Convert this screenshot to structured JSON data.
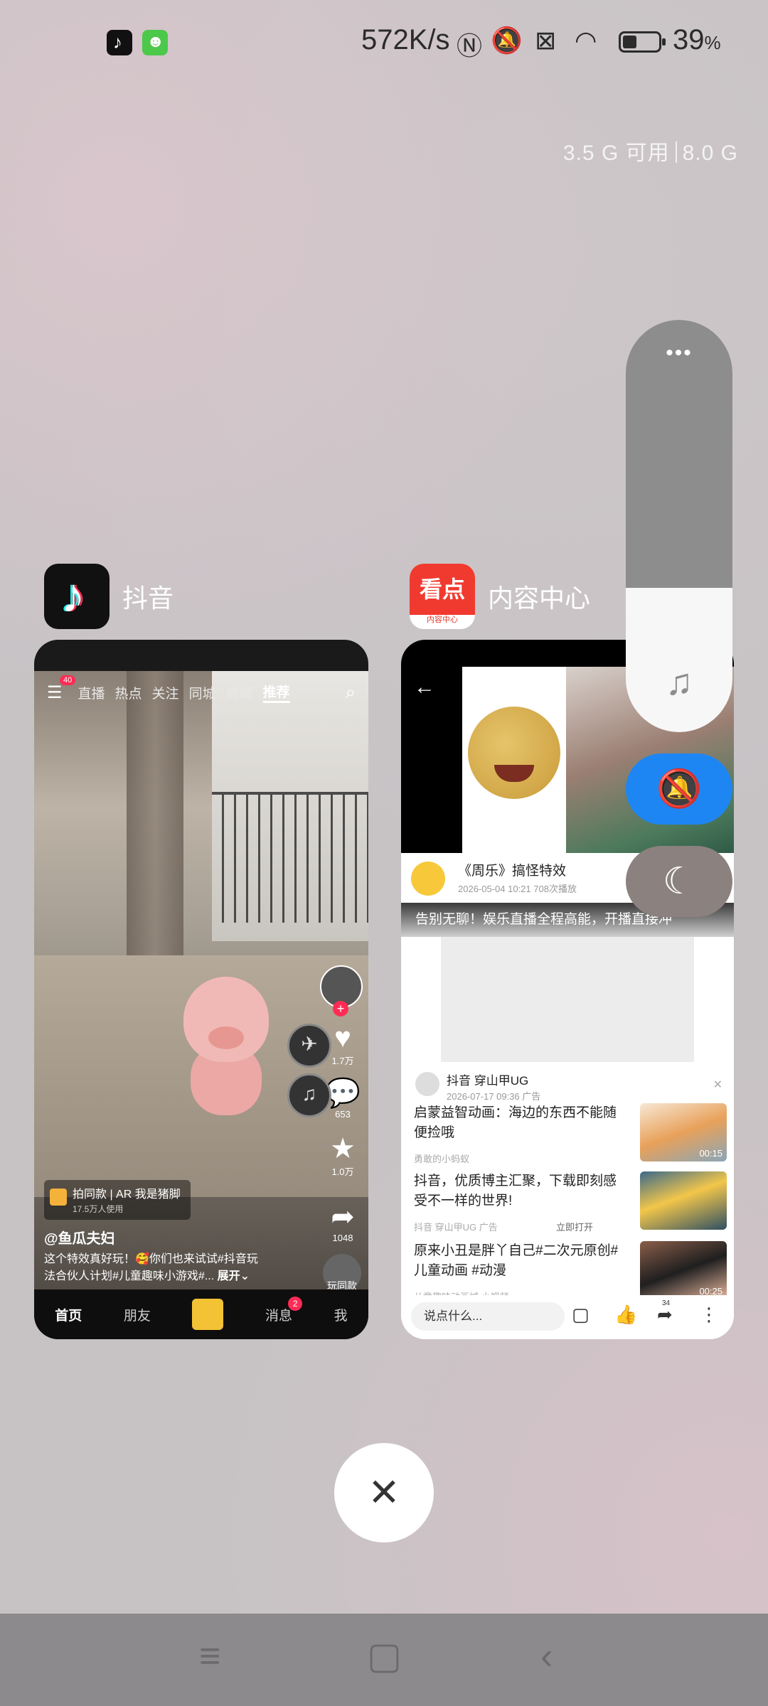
{
  "status_bar": {
    "speed": "572K/s",
    "battery_pct": "39",
    "pct_sign": "%",
    "battery_level": 0.39,
    "icons": [
      "nfc-icon",
      "mute-icon",
      "no-sim-icon",
      "wifi-icon",
      "battery-icon"
    ]
  },
  "memory": {
    "available": "3.5 G 可用",
    "total": "8.0 G"
  },
  "apps": [
    {
      "name": "抖音"
    },
    {
      "name": "内容中心",
      "logo_text": "看点",
      "logo_sub": "内容中心"
    }
  ],
  "douyin": {
    "inbox_badge": "40",
    "tabs": [
      "直播",
      "热点",
      "关注",
      "同城",
      "商城",
      "推荐"
    ],
    "active_tab": "推荐",
    "likes": "1.7万",
    "comments": "653",
    "favorites": "1.0万",
    "shares": "1048",
    "ar_title": "拍同款 | AR 我是猪脚",
    "ar_users": "17.5万人使用",
    "username": "@鱼瓜夫妇",
    "caption_line1": "这个特效真好玩！🥰你们也来试试#抖音玩",
    "caption_line2": "法合伙人计划#儿童趣味小游戏#...",
    "expand": "展开",
    "play_same": "玩同款",
    "bottom_nav": [
      "首页",
      "朋友",
      "消息",
      "我"
    ],
    "message_badge": "2"
  },
  "kandian": {
    "video_title": "《周乐》搞怪特效",
    "video_meta": "2026-05-04 10:21 708次播放",
    "banner": "告别无聊！娱乐直播全程高能，开播直接冲",
    "ad_name": "抖音  穿山甲UG",
    "ad_meta": "2026-07-17 09:36  广告",
    "items": [
      {
        "title": "启蒙益智动画：海边的东西不能随便捡哦",
        "meta": "勇敢的小蚂蚁",
        "duration": "00:15",
        "open": ""
      },
      {
        "title": "抖音，优质博主汇聚，下载即刻感受不一样的世界!",
        "meta": "抖音  穿山甲UG  广告",
        "duration": "",
        "open": "立即打开"
      },
      {
        "title": "原来小丑是胖丫自己#二次元原创#儿童动画 #动漫",
        "meta": "儿童趣味动画城  小视频",
        "duration": "00:25",
        "open": ""
      }
    ],
    "comment_placeholder": "说点什么...",
    "like_count": "34"
  },
  "control_panel": {
    "volume_level": 0.35
  }
}
